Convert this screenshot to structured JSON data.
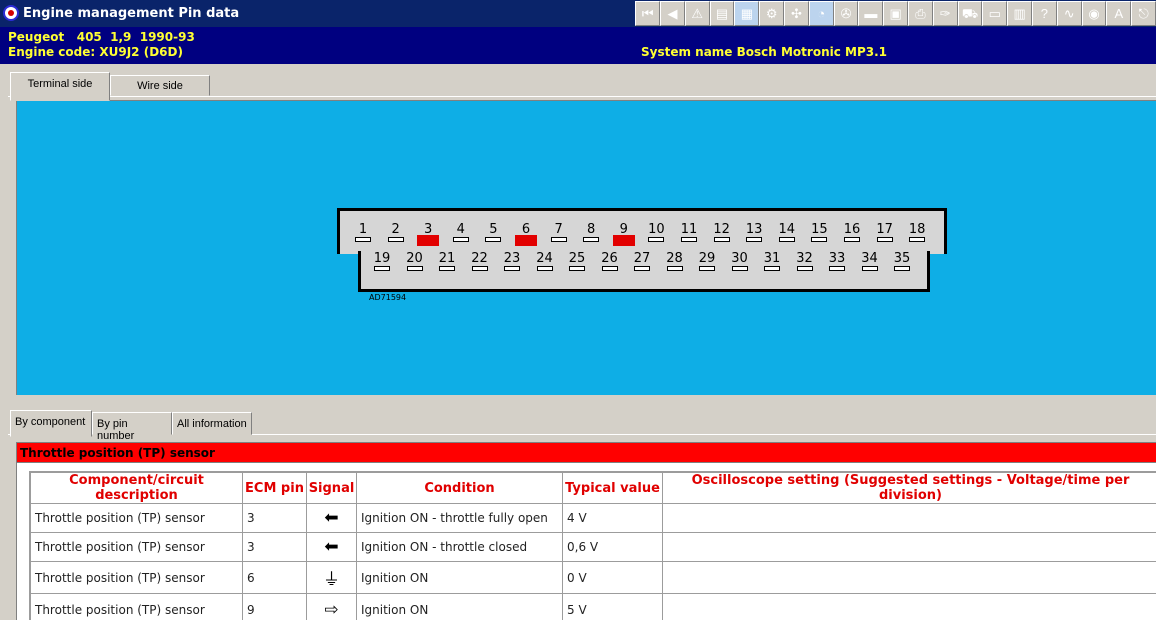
{
  "window": {
    "title": "Engine management Pin data",
    "app_icon": "app-logo-icon"
  },
  "toolbar": [
    {
      "icon": "first-icon",
      "glyph": "⏮"
    },
    {
      "icon": "back-icon",
      "glyph": "◀"
    },
    {
      "icon": "warning-icon",
      "glyph": "⚠"
    },
    {
      "icon": "document-icon",
      "glyph": "▤"
    },
    {
      "icon": "diagram-icon",
      "glyph": "▦"
    },
    {
      "icon": "gear-icon",
      "glyph": "⚙"
    },
    {
      "icon": "tools-icon",
      "glyph": "✣"
    },
    {
      "icon": "gauge-icon",
      "glyph": "◔"
    },
    {
      "icon": "engine-icon",
      "glyph": "✇"
    },
    {
      "icon": "battery-icon",
      "glyph": "▬"
    },
    {
      "icon": "save-icon",
      "glyph": "▣"
    },
    {
      "icon": "printer-icon",
      "glyph": "⎙"
    },
    {
      "icon": "wrench-icon",
      "glyph": "✑"
    },
    {
      "icon": "car-icon",
      "glyph": "⛟"
    },
    {
      "icon": "pages-icon",
      "glyph": "▭"
    },
    {
      "icon": "book-icon",
      "glyph": "▥"
    },
    {
      "icon": "help-icon",
      "glyph": "?"
    },
    {
      "icon": "wiring-icon",
      "glyph": "∿"
    },
    {
      "icon": "globe-icon",
      "glyph": "◉"
    },
    {
      "icon": "font-icon",
      "glyph": "A"
    },
    {
      "icon": "exit-icon",
      "glyph": "⎋"
    }
  ],
  "info": {
    "vehicle": "Peugeot   405  1,9  1990-93",
    "engine_code": "Engine code: XU9J2 (D6D)",
    "system_name": "System name Bosch Motronic MP3.1"
  },
  "view_tabs": [
    {
      "label": "Terminal side",
      "active": true
    },
    {
      "label": "Wire side",
      "active": false
    }
  ],
  "connector": {
    "part_number": "AD71594",
    "highlighted_pins": [
      "3",
      "6",
      "9"
    ],
    "highlight_color": "#e20000",
    "upper_row": [
      "1",
      "2",
      "3",
      "4",
      "5",
      "6",
      "7",
      "8",
      "9",
      "10",
      "11",
      "12",
      "13",
      "14",
      "15",
      "16",
      "17",
      "18"
    ],
    "lower_row": [
      "19",
      "20",
      "21",
      "22",
      "23",
      "24",
      "25",
      "26",
      "27",
      "28",
      "29",
      "30",
      "31",
      "32",
      "33",
      "34",
      "35"
    ]
  },
  "info_tabs": [
    {
      "label": "By component",
      "active": true
    },
    {
      "label": "By pin number",
      "active": false
    },
    {
      "label": "All information",
      "active": false
    }
  ],
  "section": {
    "title": "Throttle position (TP) sensor"
  },
  "table": {
    "headers": [
      "Component/circuit description",
      "ECM pin",
      "Signal",
      "Condition",
      "Typical value",
      "Oscilloscope setting (Suggested settings - Voltage/time per division)"
    ],
    "rows": [
      {
        "component": "Throttle position (TP) sensor",
        "pin": "3",
        "signal_icon": "arrow-left-icon",
        "signal_glyph": "⬅",
        "condition": "Ignition ON - throttle fully open",
        "value": "4 V",
        "scope": ""
      },
      {
        "component": "Throttle position (TP) sensor",
        "pin": "3",
        "signal_icon": "arrow-left-icon",
        "signal_glyph": "⬅",
        "condition": "Ignition ON - throttle closed",
        "value": "0,6 V",
        "scope": ""
      },
      {
        "component": "Throttle position (TP) sensor",
        "pin": "6",
        "signal_icon": "ground-icon",
        "signal_glyph": "⏚",
        "condition": "Ignition ON",
        "value": "0 V",
        "scope": ""
      },
      {
        "component": "Throttle position (TP) sensor",
        "pin": "9",
        "signal_icon": "arrow-right-outline-icon",
        "signal_glyph": "⇨",
        "condition": "Ignition ON",
        "value": "5 V",
        "scope": ""
      }
    ]
  }
}
